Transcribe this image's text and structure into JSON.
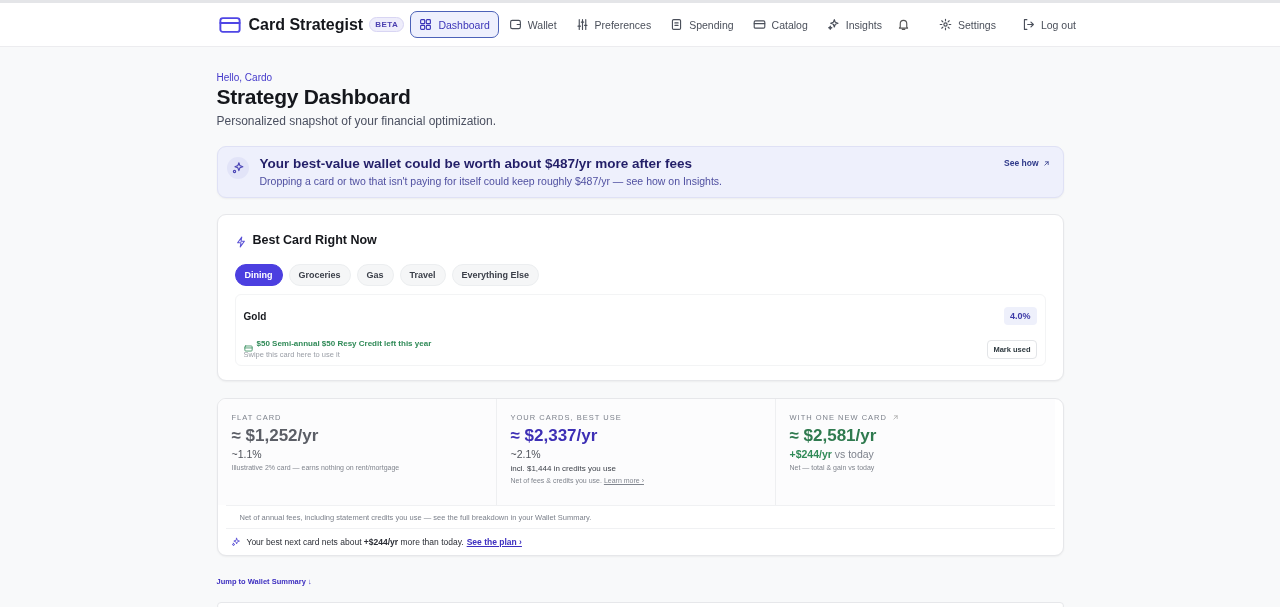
{
  "brand": {
    "name": "Card Strategist",
    "badge": "BETA"
  },
  "nav": [
    {
      "label": "Dashboard",
      "selected": true
    },
    {
      "label": "Wallet",
      "selected": false
    },
    {
      "label": "Preferences",
      "selected": false
    },
    {
      "label": "Spending",
      "selected": false
    },
    {
      "label": "Catalog",
      "selected": false
    },
    {
      "label": "Insights",
      "selected": false
    }
  ],
  "nav_right": [
    {
      "kind": "bell"
    },
    {
      "kind": "settings",
      "label": "Settings"
    },
    {
      "kind": "logout",
      "label": "Log out"
    }
  ],
  "header": {
    "greeting": "Hello, Cardo",
    "title": "Strategy Dashboard",
    "subtitle": "Personalized snapshot of your financial optimization."
  },
  "banner": {
    "title": "Your best-value wallet could be worth about $487/yr more after fees",
    "text": "Dropping a card or two that isn't paying for itself could keep roughly $487/yr — see how on Insights.",
    "link": "See how"
  },
  "best_card": {
    "title": "Best Card Right Now",
    "categories": [
      {
        "label": "Dining",
        "selected": true
      },
      {
        "label": "Groceries",
        "selected": false
      },
      {
        "label": "Gas",
        "selected": false
      },
      {
        "label": "Travel",
        "selected": false
      },
      {
        "label": "Everything Else",
        "selected": false
      }
    ],
    "card": {
      "name": "Gold",
      "rate": "4.0%",
      "credit": "$50 Semi-annual $50 Resy Credit left this year",
      "hint": "Swipe this card here to use it",
      "action": "Mark used"
    }
  },
  "stats": [
    {
      "kind": "flat",
      "label": "FLAT CARD",
      "value": "≈ $1,252/yr",
      "rate": "~1.1%",
      "note": "Illustrative 2% card — earns nothing on rent/mortgage"
    },
    {
      "kind": "yours",
      "label": "YOUR CARDS, BEST USE",
      "value": "≈ $2,337/yr",
      "rate": "~2.1%",
      "detail": "incl. $1,444 in credits you use",
      "note": "Net of fees & credits you use.",
      "link": "Learn more ›"
    },
    {
      "kind": "new",
      "label": "WITH ONE NEW CARD",
      "value": "≈ $2,581/yr",
      "gain": "+$244/yr",
      "gain_suffix": "vs today",
      "note": "Net — total & gain vs today"
    }
  ],
  "stats_footnote": "Net of annual fees, including statement credits you use — see the full breakdown in your Wallet Summary.",
  "next_card": {
    "text": "Your best next card nets about **+$244/yr** more than today.",
    "link": "See the plan ›"
  },
  "jump_link": "Jump to Wallet Summary ↓"
}
